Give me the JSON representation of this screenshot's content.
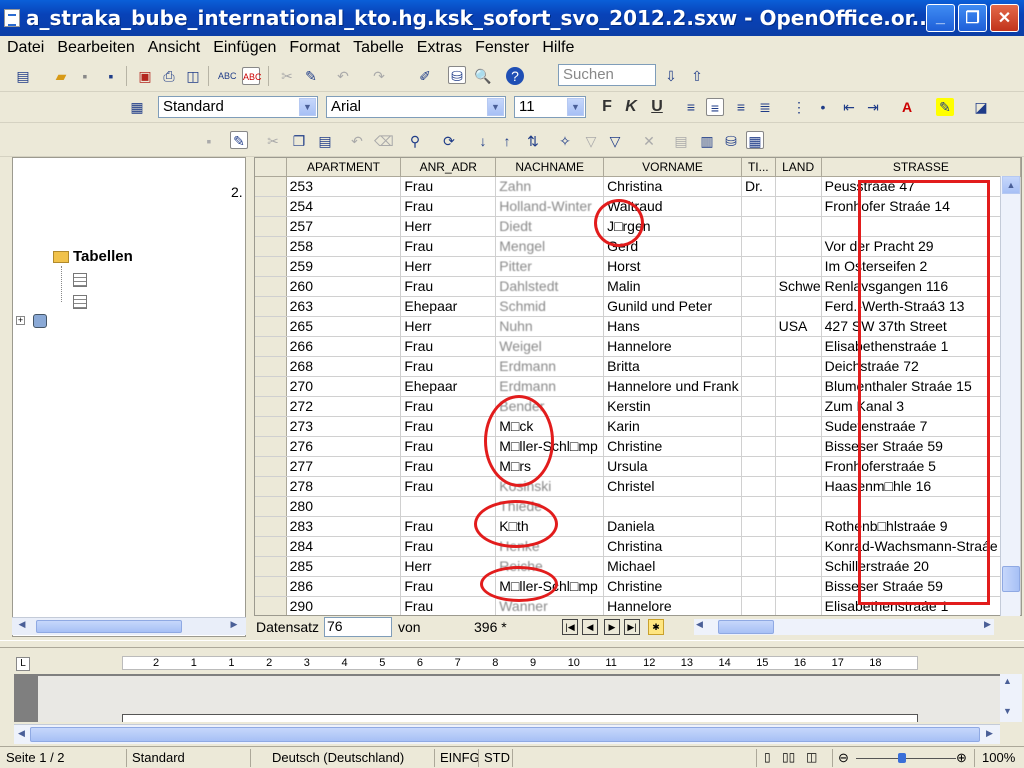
{
  "window": {
    "title": "a_straka_bube_international_kto.hg.ksk_sofort_svo_2012.2.sxw - OpenOffice.or...",
    "min": "_",
    "max": "❐",
    "close": "✕"
  },
  "menu": [
    "Datei",
    "Bearbeiten",
    "Ansicht",
    "Einfügen",
    "Format",
    "Tabelle",
    "Extras",
    "Fenster",
    "Hilfe"
  ],
  "toolbar": {
    "search_placeholder": "Suchen",
    "paragraph_style": "Standard",
    "font_name": "Arial",
    "font_size": "11",
    "bold": "F",
    "italic": "K",
    "underline": "U"
  },
  "left_panel": {
    "number": "2.",
    "tabellen_label": "Tabellen",
    "expand": "+"
  },
  "grid": {
    "columns": [
      "",
      "APARTMENT",
      "ANR_ADR",
      "NACHNAME",
      "VORNAME",
      "TI...",
      "LAND",
      "STRASSE"
    ],
    "rows": [
      [
        "253",
        "Frau",
        "Zahn",
        "Christina",
        "Dr.",
        "",
        "Peusstraáe 47"
      ],
      [
        "254",
        "Frau",
        "Holland-Winter",
        "Waltraud",
        "",
        "",
        "Fronhofer Straáe 14"
      ],
      [
        "257",
        "Herr",
        "Diedt",
        "J□rgen",
        "",
        "",
        ""
      ],
      [
        "258",
        "Frau",
        "Mengel",
        "Gerd",
        "",
        "",
        "Vor der Pracht 29"
      ],
      [
        "259",
        "Herr",
        "Pitter",
        "Horst",
        "",
        "",
        "Im Osterseifen 2"
      ],
      [
        "260",
        "Frau",
        "Dahlstedt",
        "Malin",
        "",
        "Schwe",
        "Renlavsgangen 116"
      ],
      [
        "263",
        "Ehepaar",
        "Schmid",
        "Gunild und Peter",
        "",
        "",
        "Ferd.-Werth-Straá3 13"
      ],
      [
        "265",
        "Herr",
        "Nuhn",
        "Hans",
        "",
        "USA",
        "427 SW 37th Street"
      ],
      [
        "266",
        "Frau",
        "Weigel",
        "Hannelore",
        "",
        "",
        "Elisabethenstraáe 1"
      ],
      [
        "268",
        "Frau",
        "Erdmann",
        "Britta",
        "",
        "",
        "Deichstraáe 72"
      ],
      [
        "270",
        "Ehepaar",
        "Erdmann",
        "Hannelore und Frank",
        "",
        "",
        "Blumenthaler Straáe 15"
      ],
      [
        "272",
        "Frau",
        "Bender",
        "Kerstin",
        "",
        "",
        "Zum Kanal 3"
      ],
      [
        "273",
        "Frau",
        "M□ck",
        "Karin",
        "",
        "",
        "Sudetenstraáe 7"
      ],
      [
        "276",
        "Frau",
        "M□ller-Schl□mp",
        "Christine",
        "",
        "",
        "Bisseser Straáe 59"
      ],
      [
        "277",
        "Frau",
        "M□rs",
        "Ursula",
        "",
        "",
        "Fronhoferstraáe 5"
      ],
      [
        "278",
        "Frau",
        "Kosinski",
        "Christel",
        "",
        "",
        "Haasenm□hle 16"
      ],
      [
        "280",
        "",
        "Thiede",
        "",
        "",
        "",
        ""
      ],
      [
        "283",
        "Frau",
        "K□th",
        "Daniela",
        "",
        "",
        "Rothenb□hlstraáe 9"
      ],
      [
        "284",
        "Frau",
        "Henke",
        "Christina",
        "",
        "",
        "Konrad-Wachsmann-Straáe"
      ],
      [
        "285",
        "Herr",
        "Reiche",
        "Michael",
        "",
        "",
        "Schillerstraáe 20"
      ],
      [
        "286",
        "Frau",
        "M□ller-Schl□mp",
        "Christine",
        "",
        "",
        "Bisseser Straáe 59"
      ],
      [
        "290",
        "Frau",
        "Wanner",
        "Hannelore",
        "",
        "",
        "Elisabethenstraáe 1"
      ]
    ],
    "blurred_rows": [
      0,
      1,
      2,
      3,
      4,
      5,
      6,
      7,
      8,
      9,
      10,
      11,
      15,
      16,
      18,
      19,
      21
    ]
  },
  "recordbar": {
    "label": "Datensatz",
    "current": "76",
    "of_label": "von",
    "total": "396 *"
  },
  "ruler": {
    "ticks": [
      "2",
      "1",
      "1",
      "2",
      "3",
      "4",
      "5",
      "6",
      "7",
      "8",
      "9",
      "10",
      "11",
      "12",
      "13",
      "14",
      "15",
      "16",
      "17",
      "18"
    ]
  },
  "statusbar": {
    "page": "Seite 1 / 2",
    "style": "Standard",
    "language": "Deutsch (Deutschland)",
    "insert_mode": "EINFG",
    "selection_mode": "STD",
    "zoom": "100%"
  },
  "colors": {
    "annotation": "#e21c1c",
    "titlebar": "#0842b8"
  }
}
